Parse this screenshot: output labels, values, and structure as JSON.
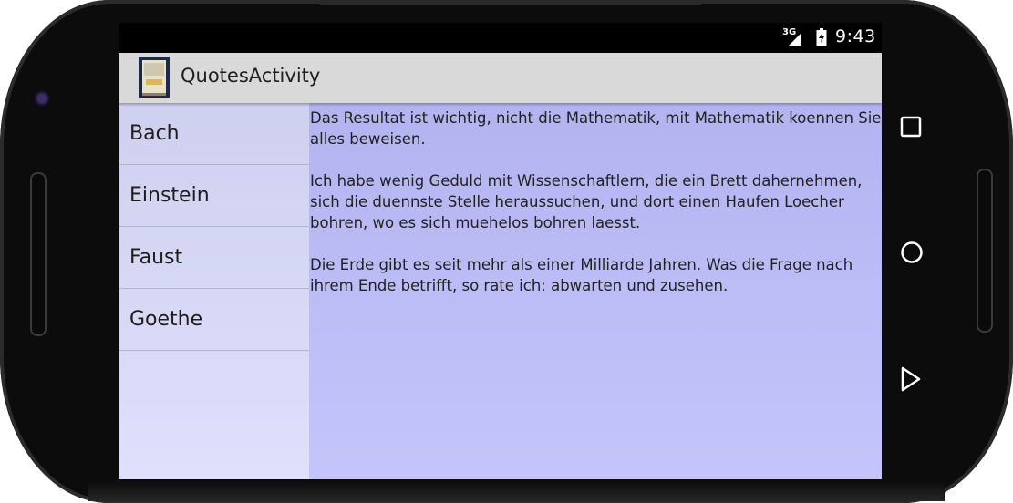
{
  "status_bar": {
    "network": "3G",
    "time": "9:43"
  },
  "action_bar": {
    "title": "QuotesActivity"
  },
  "list": {
    "items": [
      {
        "label": "Bach"
      },
      {
        "label": "Einstein"
      },
      {
        "label": "Faust"
      },
      {
        "label": "Goethe"
      }
    ]
  },
  "detail": {
    "text": "Das Resultat ist wichtig, nicht die Mathematik, mit Mathematik koennen Sie alles beweisen.\n\nIch habe wenig Geduld mit Wissenschaftlern, die ein Brett dahernehmen, sich die duennste Stelle heraussuchen, und dort einen Haufen Loecher bohren, wo es sich muehelos bohren laesst.\n\nDie Erde gibt es seit mehr als einer Milliarde Jahren. Was die Frage nach ihrem Ende betrifft, so rate ich: abwarten und zusehen."
  },
  "nav": {
    "recent_icon": "square-icon",
    "home_icon": "circle-icon",
    "back_icon": "triangle-back-icon"
  },
  "colors": {
    "list_bg": "#d6d6f5",
    "detail_bg": "#bdbdf7",
    "action_bar_bg": "#d9d9d9"
  }
}
